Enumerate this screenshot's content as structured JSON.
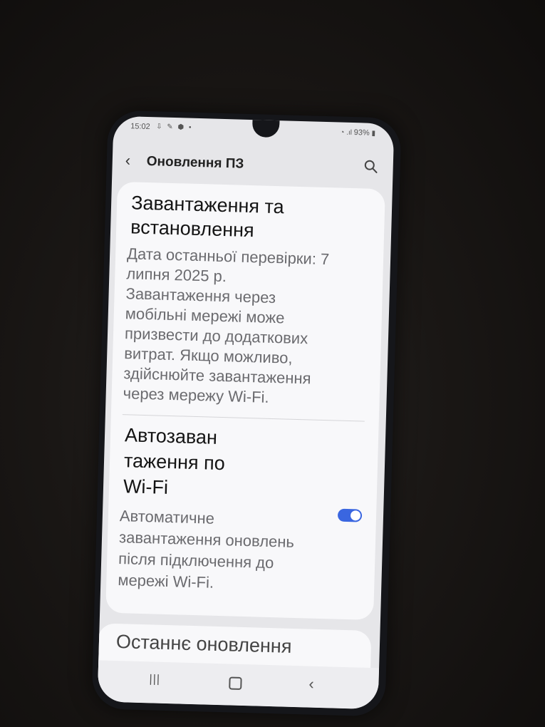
{
  "status_bar": {
    "time": "15:02",
    "left_icons": "⇩ ✎ ⬢ •",
    "battery": "93%"
  },
  "header": {
    "title": "Оновлення ПЗ"
  },
  "download_section": {
    "title_line1": "Завантаження та",
    "title_line2": "встановлення",
    "desc_lines": [
      "Дата останньої перевірки: 7",
      "липня 2025 р.",
      "Завантаження через",
      "мобільні мережі може",
      "призвести до додаткових",
      "витрат. Якщо можливо,",
      "здійснюйте завантаження",
      "через мережу Wi-Fi."
    ]
  },
  "auto_download": {
    "title_lines": [
      "Автозаван",
      "таження по",
      "Wi-Fi"
    ],
    "desc_lines": [
      "Автоматичне",
      "завантаження оновлень",
      "після підключення до",
      "мережі Wi-Fi."
    ],
    "toggle_on": true
  },
  "last_update": {
    "title": "Останнє оновлення"
  },
  "colors": {
    "accent": "#3a66e0"
  },
  "icons": {
    "back": "back-chevron-icon",
    "search": "search-icon"
  }
}
